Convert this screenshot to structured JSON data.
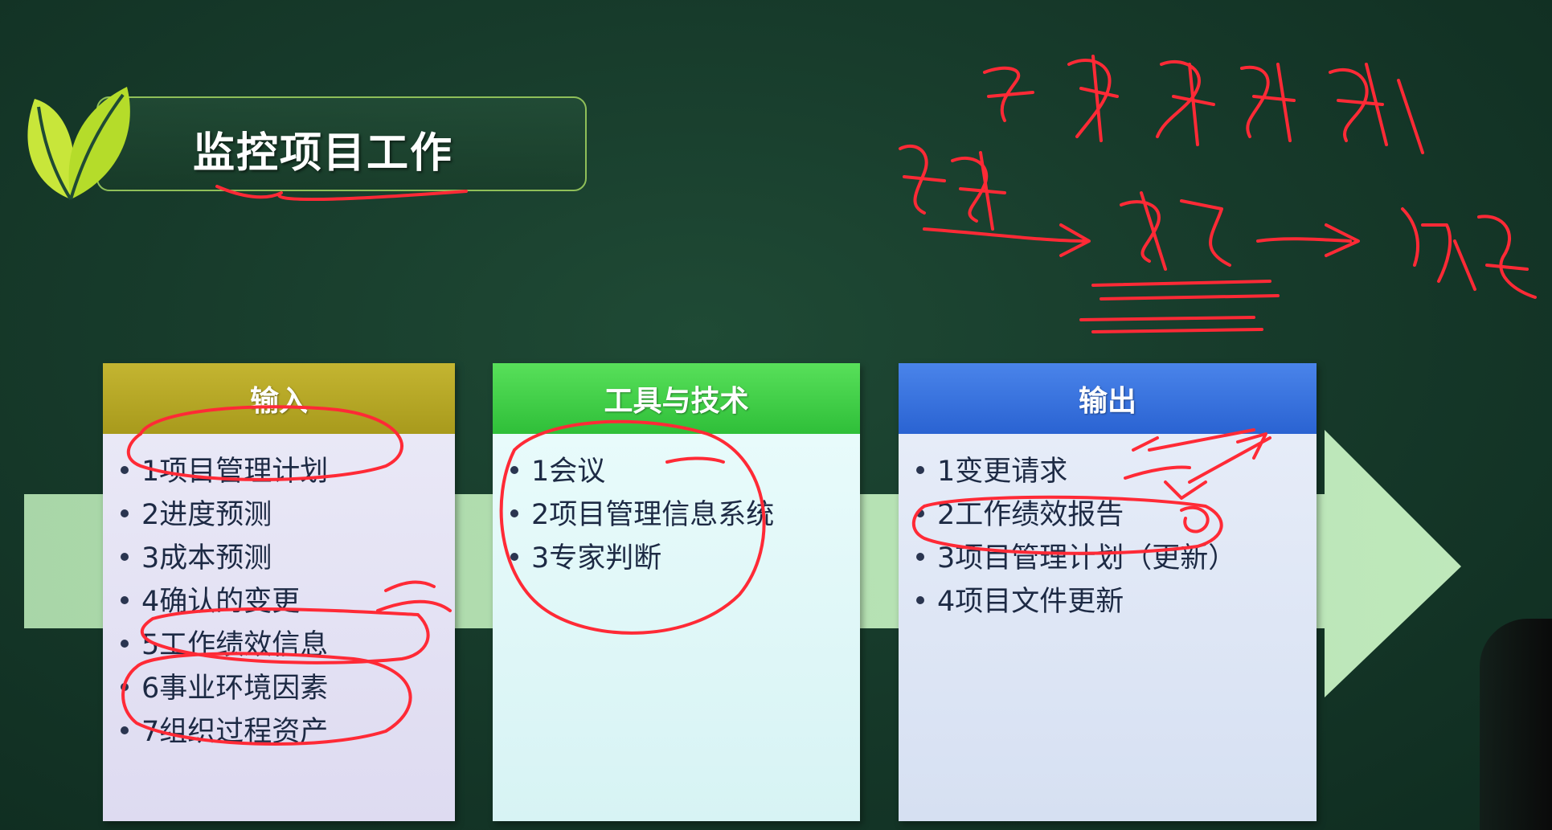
{
  "title": "监控项目工作",
  "columns": {
    "input": {
      "header": "输入",
      "items": [
        "1项目管理计划",
        "2进度预测",
        "3成本预测",
        "4确认的变更",
        "5工作绩效信息",
        "6事业环境因素",
        "7组织过程资产"
      ]
    },
    "tools": {
      "header": "工具与技术",
      "items": [
        "1会议",
        "2项目管理信息系统",
        "3专家判断"
      ]
    },
    "output": {
      "header": "输出",
      "items": [
        "1变更请求",
        "2工作绩效报告",
        "3项目管理计划（更新）",
        "4项目文件更新"
      ]
    }
  },
  "colors": {
    "input_header": "#b5a726",
    "tools_header": "#3fcf47",
    "output_header": "#3a72df",
    "annotation_ink": "#ff2a36"
  }
}
